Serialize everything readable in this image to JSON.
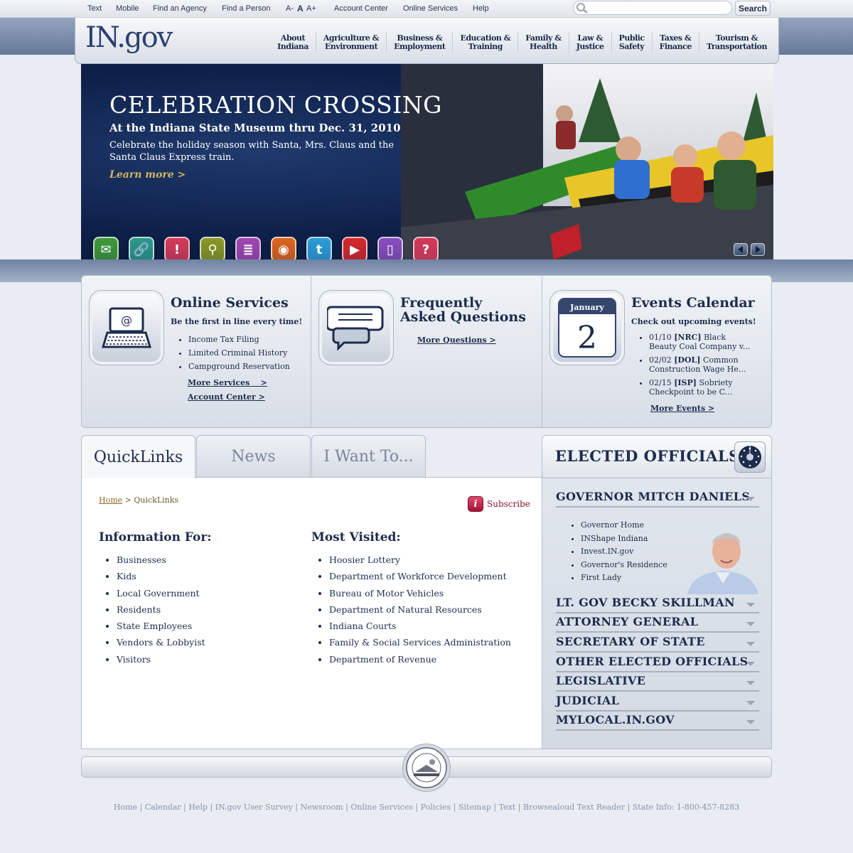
{
  "utility_nav": {
    "text": "Text",
    "mobile": "Mobile",
    "find_agency": "Find an Agency",
    "find_person": "Find a Person",
    "font_small": "A-",
    "font_normal": "A",
    "font_large": "A+",
    "account_center": "Account Center",
    "online_services": "Online Services",
    "help": "Help"
  },
  "search": {
    "placeholder": "",
    "button_label": "Search"
  },
  "logo": "IN.gov",
  "main_nav": [
    {
      "label": "About\nIndiana"
    },
    {
      "label": "Agriculture &\nEnvironment"
    },
    {
      "label": "Business &\nEmployment"
    },
    {
      "label": "Education &\nTraining"
    },
    {
      "label": "Family &\nHealth"
    },
    {
      "label": "Law &\nJustice"
    },
    {
      "label": "Public\nSafety"
    },
    {
      "label": "Taxes &\nFinance"
    },
    {
      "label": "Tourism &\nTransportation"
    }
  ],
  "hero": {
    "title": "CELEBRATION CROSSING",
    "subtitle": "At the Indiana State Museum thru Dec. 31, 2010",
    "description": "Celebrate the holiday season with Santa, Mrs. Claus and the Santa Claus Express train.",
    "learn_more": "Learn more >",
    "icons": [
      {
        "name": "email-icon",
        "color": "#3f9a3a",
        "glyph": "✉"
      },
      {
        "name": "link-icon",
        "color": "#2d9a8c",
        "glyph": "🔗"
      },
      {
        "name": "alert-icon",
        "color": "#d83a5a",
        "glyph": "!"
      },
      {
        "name": "person-search-icon",
        "color": "#8a9a24",
        "glyph": "⚲"
      },
      {
        "name": "document-icon",
        "color": "#a247b3",
        "glyph": "≣"
      },
      {
        "name": "rss-icon",
        "color": "#e0661e",
        "glyph": "◉"
      },
      {
        "name": "twitter-icon",
        "color": "#2b9fd9",
        "glyph": "t"
      },
      {
        "name": "youtube-icon",
        "color": "#d8282e",
        "glyph": "▶"
      },
      {
        "name": "mobile-icon",
        "color": "#8b4fc0",
        "glyph": "▯"
      },
      {
        "name": "help-icon",
        "color": "#d8375a",
        "glyph": "?"
      }
    ]
  },
  "features": {
    "online_services": {
      "title": "Online Services",
      "subtitle": "Be the first in line every time!",
      "items": [
        "Income Tax Filing",
        "Limited Criminal History",
        "Campground Reservation"
      ],
      "more_services": "More Services    >",
      "account_center": "Account Center >"
    },
    "faq": {
      "title": "Frequently Asked Questions",
      "more": "More Questions >"
    },
    "events": {
      "title": "Events Calendar",
      "subtitle": "Check out upcoming events!",
      "calendar_month": "January",
      "calendar_day": "2",
      "items": [
        {
          "date": "01/10",
          "agency": "[NRC]",
          "text": "Black Beauty Coal Company v..."
        },
        {
          "date": "02/02",
          "agency": "[DOL]",
          "text": "Common Construction Wage He..."
        },
        {
          "date": "02/15",
          "agency": "[ISP]",
          "text": "Sobriety Checkpoint to be C..."
        }
      ],
      "more": "More Events >"
    }
  },
  "tabs": {
    "quicklinks": "QuickLinks",
    "news": "News",
    "i_want_to": "I Want To..."
  },
  "breadcrumb": {
    "home": "Home",
    "separator": ">",
    "current": "QuickLinks"
  },
  "subscribe": "Subscribe",
  "information_for": {
    "heading": "Information For:",
    "items": [
      "Businesses",
      "Kids",
      "Local Government",
      "Residents",
      "State Employees",
      "Vendors & Lobbyist",
      "Visitors"
    ]
  },
  "most_visited": {
    "heading": "Most Visited:",
    "items": [
      "Hoosier Lottery",
      "Department of Workforce Development",
      "Bureau of Motor Vehicles",
      "Department of Natural Resources",
      "Indiana Courts",
      "Family & Social Services Administration",
      "Department of Revenue"
    ]
  },
  "elected_officials": {
    "title": "ELECTED OFFICIALS",
    "governor": {
      "label": "GOVERNOR MITCH DANIELS",
      "links": [
        "Governor Home",
        "INShape Indiana",
        "Invest.IN.gov",
        "Governor's Residence",
        "First Lady"
      ]
    },
    "others": [
      "LT. GOV BECKY SKILLMAN",
      "ATTORNEY GENERAL",
      "SECRETARY OF STATE",
      "OTHER ELECTED OFFICIALS",
      "LEGISLATIVE",
      "JUDICIAL",
      "MYLOCAL.IN.GOV"
    ]
  },
  "footer_links": [
    "Home",
    "Calendar",
    "Help",
    "IN.gov User Survey",
    "Newsroom",
    "Online Services",
    "Policies",
    "Sitemap",
    "Text",
    "Browsealoud Text Reader",
    "State Info: 1-800-457-8283"
  ]
}
